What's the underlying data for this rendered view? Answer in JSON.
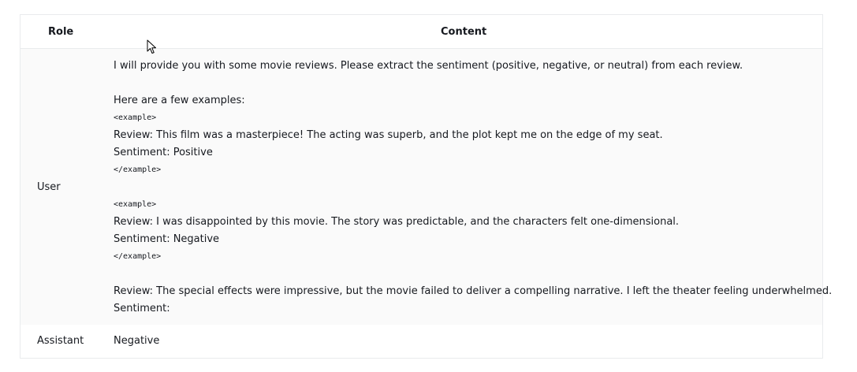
{
  "table": {
    "headers": {
      "role": "Role",
      "content": "Content"
    },
    "rows": [
      {
        "role": "User",
        "content": {
          "line1": "I will provide you with some movie reviews. Please extract the sentiment (positive, negative, or neutral) from each review.",
          "line2": "Here are a few examples:",
          "ex1_open": "<example>",
          "ex1_review": "Review: This film was a masterpiece! The acting was superb, and the plot kept me on the edge of my seat.",
          "ex1_sentiment": "Sentiment: Positive",
          "ex1_close": "</example>",
          "ex2_open": "<example>",
          "ex2_review": "Review: I was disappointed by this movie. The story was predictable, and the characters felt one-dimensional.",
          "ex2_sentiment": "Sentiment: Negative",
          "ex2_close": "</example>",
          "final_review": "Review: The special effects were impressive, but the movie failed to deliver a compelling narrative. I left the theater feeling underwhelmed.",
          "final_sentiment": "Sentiment:"
        }
      },
      {
        "role": "Assistant",
        "content": "Negative"
      }
    ]
  },
  "cursor": {
    "icon": "mouse-pointer-icon"
  }
}
